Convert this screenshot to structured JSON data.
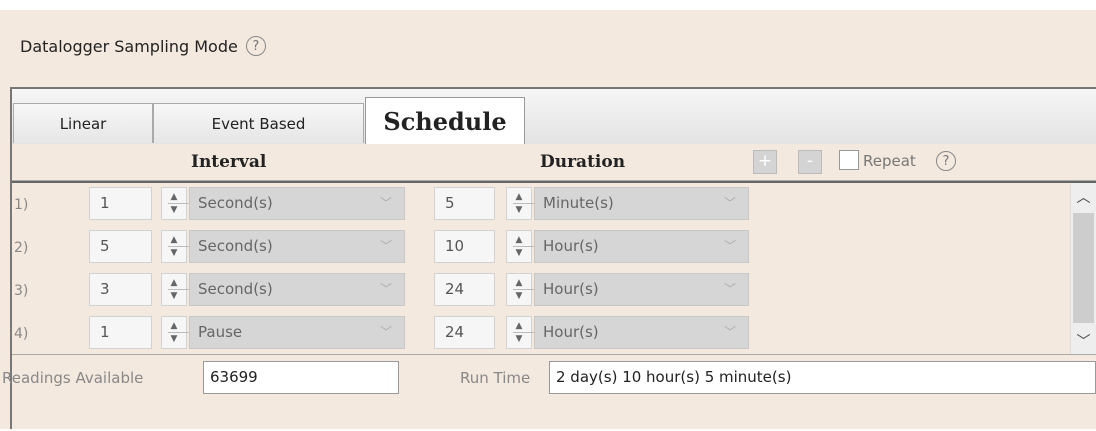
{
  "window": {
    "title": "Datalogger Sampling Mode",
    "help_icon": "?"
  },
  "tabs": [
    {
      "label": "Linear",
      "active": false
    },
    {
      "label": "Event Based",
      "active": false
    },
    {
      "label": "Schedule",
      "active": true
    }
  ],
  "schedule": {
    "interval_header": "Interval",
    "duration_header": "Duration",
    "add_label": "+",
    "remove_label": "-",
    "repeat_label": "Repeat",
    "repeat_checked": false,
    "repeat_help": "?",
    "rows": [
      {
        "num": "1)",
        "interval_value": "1",
        "interval_unit": "Second(s)",
        "duration_value": "5",
        "duration_unit": "Minute(s)"
      },
      {
        "num": "2)",
        "interval_value": "5",
        "interval_unit": "Second(s)",
        "duration_value": "10",
        "duration_unit": "Hour(s)"
      },
      {
        "num": "3)",
        "interval_value": "3",
        "interval_unit": "Second(s)",
        "duration_value": "24",
        "duration_unit": "Hour(s)"
      },
      {
        "num": "4)",
        "interval_value": "1",
        "interval_unit": "Pause",
        "duration_value": "24",
        "duration_unit": "Hour(s)"
      }
    ]
  },
  "footer": {
    "readings_label": "Readings Available",
    "readings_value": "63699",
    "runtime_label": "Run Time",
    "runtime_value": "2 day(s) 10 hour(s) 5 minute(s)"
  },
  "colors": {
    "background": "#f4e9df",
    "disabled_combo": "#d6d6d6"
  }
}
